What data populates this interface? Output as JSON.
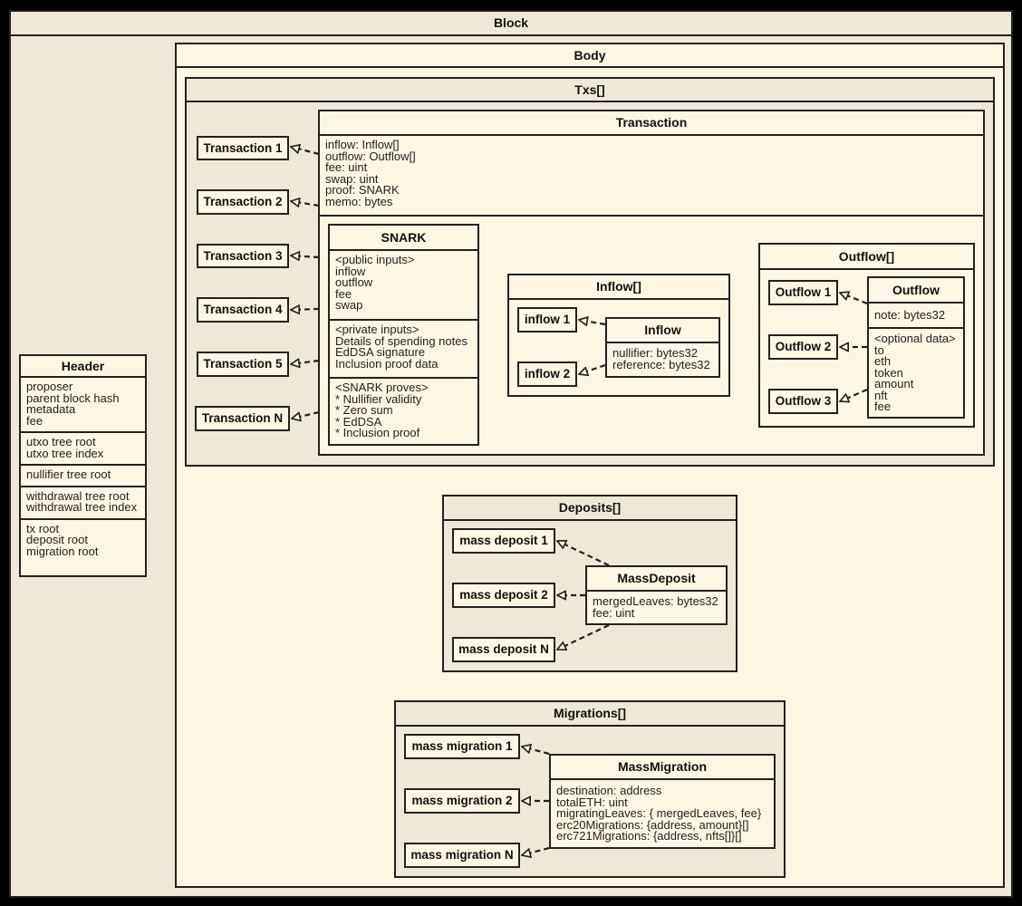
{
  "block": {
    "title": "Block"
  },
  "header": {
    "title": "Header",
    "sections": [
      [
        "proposer",
        "parent block hash",
        "metadata",
        "fee"
      ],
      [
        "utxo tree root",
        "utxo tree index"
      ],
      [
        "nullifier tree root"
      ],
      [
        "withdrawal tree root",
        "withdrawal tree index"
      ],
      [
        "tx root",
        "deposit root",
        "migration root"
      ]
    ]
  },
  "body": {
    "title": "Body"
  },
  "txs": {
    "title": "Txs[]",
    "items": [
      "Transaction 1",
      "Transaction 2",
      "Transaction 3",
      "Transaction 4",
      "Transaction 5",
      "Transaction N"
    ]
  },
  "transaction": {
    "title": "Transaction",
    "fields": [
      "inflow: Inflow[]",
      "outflow: Outflow[]",
      "fee: uint",
      "swap: uint",
      "proof: SNARK",
      "memo: bytes"
    ]
  },
  "snark": {
    "title": "SNARK",
    "sections": [
      [
        "<public inputs>",
        "inflow",
        "outflow",
        "fee",
        "swap"
      ],
      [
        "<private inputs>",
        "Details of spending notes",
        "EdDSA signature",
        "Inclusion proof data"
      ],
      [
        "<SNARK proves>",
        "* Nullifier validity",
        "* Zero sum",
        "* EdDSA",
        "* Inclusion proof"
      ]
    ]
  },
  "inflow_list": {
    "title": "Inflow[]",
    "items": [
      "inflow 1",
      "inflow 2"
    ]
  },
  "inflow": {
    "title": "Inflow",
    "fields": [
      "nullifier: bytes32",
      "reference: bytes32"
    ]
  },
  "outflow_list": {
    "title": "Outflow[]",
    "items": [
      "Outflow 1",
      "Outflow 2",
      "Outflow 3"
    ]
  },
  "outflow": {
    "title": "Outflow",
    "sections": [
      [
        "note: bytes32"
      ],
      [
        "<optional data>",
        "to",
        "eth",
        "token",
        "amount",
        "nft",
        "fee"
      ]
    ]
  },
  "deposits": {
    "title": "Deposits[]",
    "items": [
      "mass deposit 1",
      "mass deposit 2",
      "mass deposit N"
    ]
  },
  "mass_deposit": {
    "title": "MassDeposit",
    "fields": [
      "mergedLeaves: bytes32",
      "fee: uint"
    ]
  },
  "migrations": {
    "title": "Migrations[]",
    "items": [
      "mass migration 1",
      "mass migration 2",
      "mass migration N"
    ]
  },
  "mass_migration": {
    "title": "MassMigration",
    "fields": [
      "destination: address",
      "totalETH: uint",
      "migratingLeaves: { mergedLeaves,  fee}",
      "erc20Migrations: {address, amount}[]",
      "erc721Migrations: {address, nfts[]}[]"
    ]
  }
}
